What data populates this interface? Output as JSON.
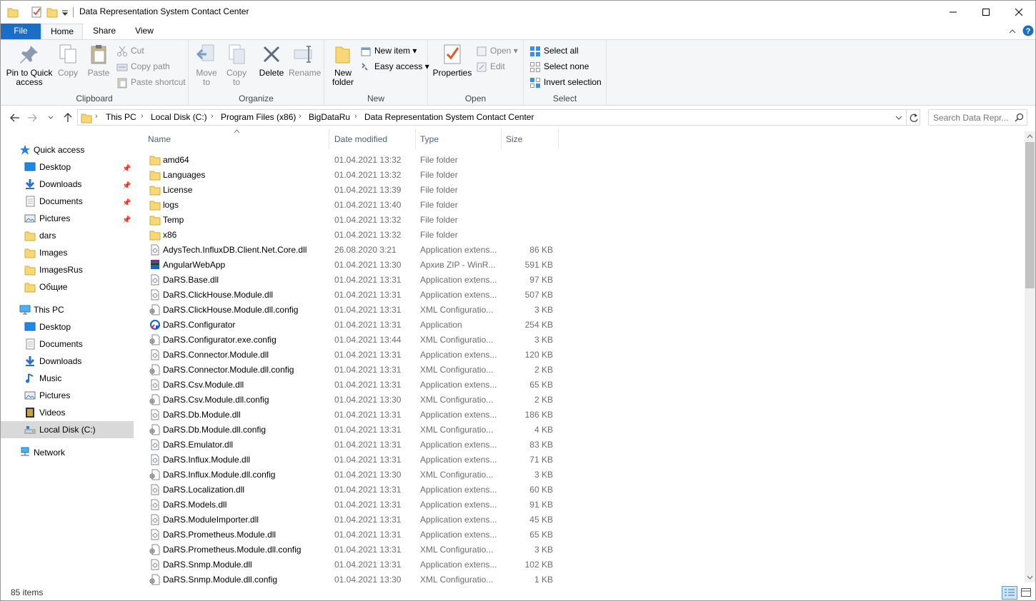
{
  "window": {
    "title": "Data Representation System Contact Center"
  },
  "ribbon": {
    "tabs": [
      "File",
      "Home",
      "Share",
      "View"
    ],
    "clipboard": {
      "label": "Clipboard",
      "pin": "Pin to Quick access",
      "copy": "Copy",
      "paste": "Paste",
      "cut": "Cut",
      "copy_path": "Copy path",
      "paste_shortcut": "Paste shortcut"
    },
    "organize": {
      "label": "Organize",
      "move_to": "Move to",
      "copy_to": "Copy to",
      "delete": "Delete",
      "rename": "Rename"
    },
    "new": {
      "label": "New",
      "new_folder": "New folder",
      "new_item": "New item",
      "easy_access": "Easy access"
    },
    "open": {
      "label": "Open",
      "properties": "Properties",
      "open": "Open",
      "edit": "Edit"
    },
    "select": {
      "label": "Select",
      "select_all": "Select all",
      "select_none": "Select none",
      "invert": "Invert selection"
    }
  },
  "address": {
    "crumbs": [
      "This PC",
      "Local Disk (C:)",
      "Program Files (x86)",
      "BigDataRu",
      "Data Representation System Contact Center"
    ]
  },
  "search": {
    "placeholder": "Search Data Repr..."
  },
  "nav": {
    "quick_access": "Quick access",
    "qa_items": [
      "Desktop",
      "Downloads",
      "Documents",
      "Pictures",
      "dars",
      "Images",
      "ImagesRus",
      "Общие"
    ],
    "this_pc": "This PC",
    "pc_items": [
      "Desktop",
      "Documents",
      "Downloads",
      "Music",
      "Pictures",
      "Videos",
      "Local Disk (C:)"
    ],
    "network": "Network"
  },
  "columns": {
    "name": "Name",
    "date": "Date modified",
    "type": "Type",
    "size": "Size"
  },
  "files": [
    {
      "name": "amd64",
      "date": "01.04.2021 13:32",
      "type": "File folder",
      "size": "",
      "icon": "folder-icon"
    },
    {
      "name": "Languages",
      "date": "01.04.2021 13:32",
      "type": "File folder",
      "size": "",
      "icon": "folder-icon"
    },
    {
      "name": "License",
      "date": "01.04.2021 13:39",
      "type": "File folder",
      "size": "",
      "icon": "folder-icon"
    },
    {
      "name": "logs",
      "date": "01.04.2021 13:40",
      "type": "File folder",
      "size": "",
      "icon": "folder-icon"
    },
    {
      "name": "Temp",
      "date": "01.04.2021 13:32",
      "type": "File folder",
      "size": "",
      "icon": "folder-icon"
    },
    {
      "name": "x86",
      "date": "01.04.2021 13:32",
      "type": "File folder",
      "size": "",
      "icon": "folder-icon"
    },
    {
      "name": "AdysTech.InfluxDB.Client.Net.Core.dll",
      "date": "26.08.2020 3:21",
      "type": "Application extens...",
      "size": "86 KB",
      "icon": "dll-icon"
    },
    {
      "name": "AngularWebApp",
      "date": "01.04.2021 13:30",
      "type": "Архив ZIP - WinR...",
      "size": "591 KB",
      "icon": "archive-icon"
    },
    {
      "name": "DaRS.Base.dll",
      "date": "01.04.2021 13:31",
      "type": "Application extens...",
      "size": "97 KB",
      "icon": "dll-icon"
    },
    {
      "name": "DaRS.ClickHouse.Module.dll",
      "date": "01.04.2021 13:31",
      "type": "Application extens...",
      "size": "507 KB",
      "icon": "dll-icon"
    },
    {
      "name": "DaRS.ClickHouse.Module.dll.config",
      "date": "01.04.2021 13:31",
      "type": "XML Configuratio...",
      "size": "3 KB",
      "icon": "config-icon"
    },
    {
      "name": "DaRS.Configurator",
      "date": "01.04.2021 13:31",
      "type": "Application",
      "size": "254 KB",
      "icon": "app-icon"
    },
    {
      "name": "DaRS.Configurator.exe.config",
      "date": "01.04.2021 13:44",
      "type": "XML Configuratio...",
      "size": "3 KB",
      "icon": "config-icon"
    },
    {
      "name": "DaRS.Connector.Module.dll",
      "date": "01.04.2021 13:31",
      "type": "Application extens...",
      "size": "120 KB",
      "icon": "dll-icon"
    },
    {
      "name": "DaRS.Connector.Module.dll.config",
      "date": "01.04.2021 13:31",
      "type": "XML Configuratio...",
      "size": "2 KB",
      "icon": "config-icon"
    },
    {
      "name": "DaRS.Csv.Module.dll",
      "date": "01.04.2021 13:31",
      "type": "Application extens...",
      "size": "65 KB",
      "icon": "dll-icon"
    },
    {
      "name": "DaRS.Csv.Module.dll.config",
      "date": "01.04.2021 13:30",
      "type": "XML Configuratio...",
      "size": "2 KB",
      "icon": "config-icon"
    },
    {
      "name": "DaRS.Db.Module.dll",
      "date": "01.04.2021 13:31",
      "type": "Application extens...",
      "size": "186 KB",
      "icon": "dll-icon"
    },
    {
      "name": "DaRS.Db.Module.dll.config",
      "date": "01.04.2021 13:31",
      "type": "XML Configuratio...",
      "size": "4 KB",
      "icon": "config-icon"
    },
    {
      "name": "DaRS.Emulator.dll",
      "date": "01.04.2021 13:31",
      "type": "Application extens...",
      "size": "83 KB",
      "icon": "dll-icon"
    },
    {
      "name": "DaRS.Influx.Module.dll",
      "date": "01.04.2021 13:31",
      "type": "Application extens...",
      "size": "71 KB",
      "icon": "dll-icon"
    },
    {
      "name": "DaRS.Influx.Module.dll.config",
      "date": "01.04.2021 13:30",
      "type": "XML Configuratio...",
      "size": "3 KB",
      "icon": "config-icon"
    },
    {
      "name": "DaRS.Localization.dll",
      "date": "01.04.2021 13:31",
      "type": "Application extens...",
      "size": "60 KB",
      "icon": "dll-icon"
    },
    {
      "name": "DaRS.Models.dll",
      "date": "01.04.2021 13:31",
      "type": "Application extens...",
      "size": "91 KB",
      "icon": "dll-icon"
    },
    {
      "name": "DaRS.ModuleImporter.dll",
      "date": "01.04.2021 13:31",
      "type": "Application extens...",
      "size": "45 KB",
      "icon": "dll-icon"
    },
    {
      "name": "DaRS.Prometheus.Module.dll",
      "date": "01.04.2021 13:31",
      "type": "Application extens...",
      "size": "65 KB",
      "icon": "dll-icon"
    },
    {
      "name": "DaRS.Prometheus.Module.dll.config",
      "date": "01.04.2021 13:31",
      "type": "XML Configuratio...",
      "size": "3 KB",
      "icon": "config-icon"
    },
    {
      "name": "DaRS.Snmp.Module.dll",
      "date": "01.04.2021 13:31",
      "type": "Application extens...",
      "size": "102 KB",
      "icon": "dll-icon"
    },
    {
      "name": "DaRS.Snmp.Module.dll.config",
      "date": "01.04.2021 13:30",
      "type": "XML Configuratio...",
      "size": "1 KB",
      "icon": "config-icon"
    }
  ],
  "status": {
    "item_count": "85 items"
  },
  "colors": {
    "accent": "#1a6fc4",
    "folder": "#f8d775",
    "selected_nav": "#d9d9d9"
  }
}
